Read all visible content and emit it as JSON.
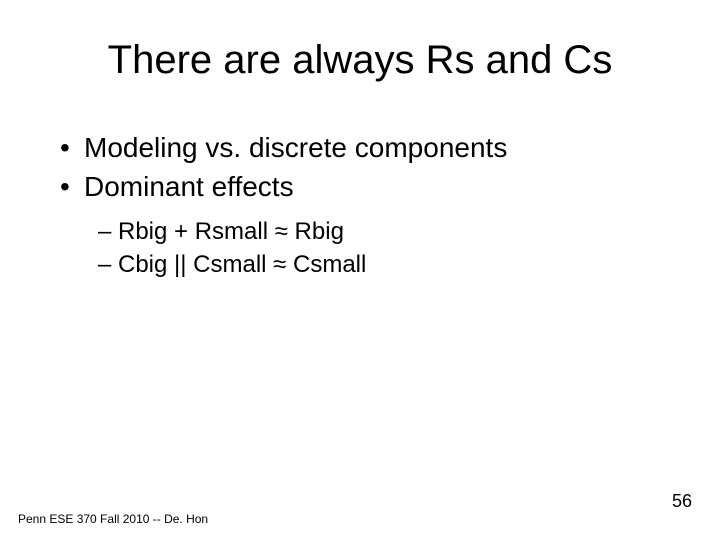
{
  "title": "There are always Rs and Cs",
  "bullets": [
    "Modeling vs. discrete components",
    "Dominant effects"
  ],
  "subbullets": [
    "Rbig + Rsmall ≈ Rbig",
    "Cbig || Csmall ≈ Csmall"
  ],
  "footer": "Penn ESE 370 Fall 2010 -- De. Hon",
  "page_number": "56"
}
